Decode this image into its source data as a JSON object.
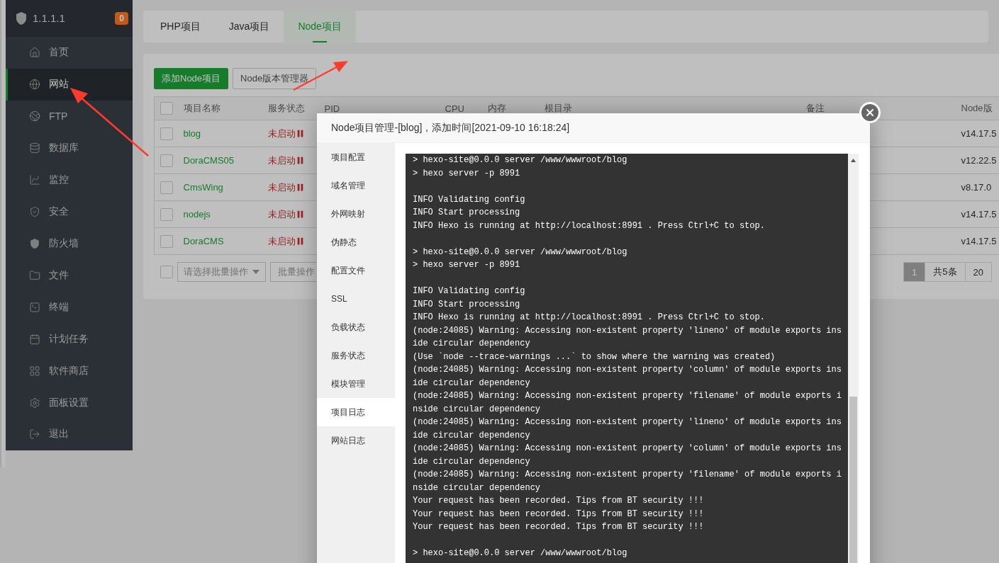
{
  "sidebar": {
    "brand": "1.1.1.1",
    "badge": "0",
    "items": [
      {
        "label": "首页",
        "selected": false
      },
      {
        "label": "网站",
        "selected": true
      },
      {
        "label": "FTP",
        "selected": false
      },
      {
        "label": "数据库",
        "selected": false
      },
      {
        "label": "监控",
        "selected": false
      },
      {
        "label": "安全",
        "selected": false
      },
      {
        "label": "防火墙",
        "selected": false
      },
      {
        "label": "文件",
        "selected": false
      },
      {
        "label": "终端",
        "selected": false
      },
      {
        "label": "计划任务",
        "selected": false
      },
      {
        "label": "软件商店",
        "selected": false
      },
      {
        "label": "面板设置",
        "selected": false
      },
      {
        "label": "退出",
        "selected": false
      }
    ]
  },
  "tabs": [
    {
      "label": "PHP项目",
      "selected": false
    },
    {
      "label": "Java项目",
      "selected": false
    },
    {
      "label": "Node项目",
      "selected": true
    }
  ],
  "toolbar": [
    {
      "label": "添加Node项目",
      "kind": "primary"
    },
    {
      "label": "Node版本管理器",
      "kind": "default"
    }
  ],
  "table": {
    "header_checked": false,
    "columns": [
      "项目名称",
      "服务状态",
      "PID",
      "CPU",
      "内存",
      "根目录",
      "备注",
      "Node版"
    ],
    "rows": [
      {
        "checked": false,
        "name": "blog",
        "status": "未启动",
        "version": "v14.17.5"
      },
      {
        "checked": false,
        "name": "DoraCMS05",
        "status": "未启动",
        "version": "v12.22.5"
      },
      {
        "checked": false,
        "name": "CmsWing",
        "status": "未启动",
        "version": "v8.17.0"
      },
      {
        "checked": false,
        "name": "nodejs",
        "status": "未启动",
        "version": "v14.17.5"
      },
      {
        "checked": false,
        "name": "DoraCMS",
        "status": "未启动",
        "version": "v14.17.5"
      }
    ]
  },
  "footer": {
    "checked": false,
    "select_placeholder": "请选择批量操作",
    "batch_button": "批量操作",
    "pager": {
      "current": "1",
      "total": "共5条",
      "page_size": "20"
    }
  },
  "modal": {
    "title": "Node项目管理-[blog]，添加时间[2021-09-10 16:18:24]",
    "nav": [
      {
        "label": "项目配置",
        "selected": false
      },
      {
        "label": "域名管理",
        "selected": false
      },
      {
        "label": "外网映射",
        "selected": false
      },
      {
        "label": "伪静态",
        "selected": false
      },
      {
        "label": "配置文件",
        "selected": false
      },
      {
        "label": "SSL",
        "selected": false
      },
      {
        "label": "负载状态",
        "selected": false
      },
      {
        "label": "服务状态",
        "selected": false
      },
      {
        "label": "模块管理",
        "selected": false
      },
      {
        "label": "项目日志",
        "selected": true
      },
      {
        "label": "网站日志",
        "selected": false
      }
    ],
    "log_blocks": [
      [
        "> hexo-site@0.0.0 server /www/wwwroot/blog",
        "> hexo server -p 8991"
      ],
      [
        "INFO Validating config",
        "INFO Start processing",
        "INFO Hexo is running at http://localhost:8991 . Press Ctrl+C to stop."
      ],
      [
        "> hexo-site@0.0.0 server /www/wwwroot/blog",
        "> hexo server -p 8991"
      ],
      [
        "INFO Validating config",
        "INFO Start processing",
        "INFO Hexo is running at http://localhost:8991 . Press Ctrl+C to stop.",
        "(node:24085) Warning: Accessing non-existent property 'lineno' of module exports ins",
        "ide circular dependency",
        "(Use `node --trace-warnings ...` to show where the warning was created)",
        "(node:24085) Warning: Accessing non-existent property 'column' of module exports ins",
        "ide circular dependency",
        "(node:24085) Warning: Accessing non-existent property 'filename' of module exports i",
        "nside circular dependency",
        "(node:24085) Warning: Accessing non-existent property 'lineno' of module exports ins",
        "ide circular dependency",
        "(node:24085) Warning: Accessing non-existent property 'column' of module exports ins",
        "ide circular dependency",
        "(node:24085) Warning: Accessing non-existent property 'filename' of module exports i",
        "nside circular dependency",
        "Your request has been recorded. Tips from BT security !!!",
        "Your request has been recorded. Tips from BT security !!!",
        "Your request has been recorded. Tips from BT security !!!"
      ],
      [
        "> hexo-site@0.0.0 server /www/wwwroot/blog"
      ]
    ]
  }
}
